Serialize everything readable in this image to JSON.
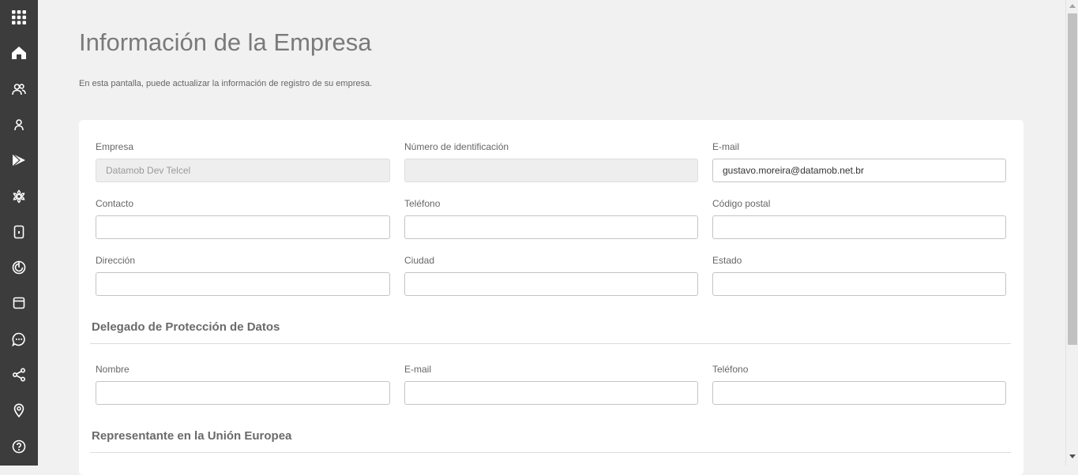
{
  "page": {
    "title": "Información de la Empresa",
    "subtitle": "En esta pantalla, puede actualizar la información de registro de su empresa."
  },
  "sidebar": {
    "items": [
      {
        "icon": "apps-grid-icon"
      },
      {
        "icon": "home-icon"
      },
      {
        "icon": "users-icon"
      },
      {
        "icon": "user-icon"
      },
      {
        "icon": "play-icon"
      },
      {
        "icon": "settings-flower-icon"
      },
      {
        "icon": "device-icon"
      },
      {
        "icon": "target-icon"
      },
      {
        "icon": "browser-window-icon"
      },
      {
        "icon": "chat-icon"
      },
      {
        "icon": "share-icon"
      },
      {
        "icon": "location-pin-icon"
      },
      {
        "icon": "help-icon"
      }
    ]
  },
  "company": {
    "empresa": {
      "label": "Empresa",
      "value": "Datamob Dev Telcel"
    },
    "numero": {
      "label": "Número de identificación",
      "value": ""
    },
    "email": {
      "label": "E-mail",
      "value": "gustavo.moreira@datamob.net.br"
    },
    "contacto": {
      "label": "Contacto",
      "value": ""
    },
    "telefono": {
      "label": "Teléfono",
      "value": ""
    },
    "codigo_postal": {
      "label": "Código postal",
      "value": ""
    },
    "direccion": {
      "label": "Dirección",
      "value": ""
    },
    "ciudad": {
      "label": "Ciudad",
      "value": ""
    },
    "estado": {
      "label": "Estado",
      "value": ""
    }
  },
  "dpo": {
    "title": "Delegado de Protección de Datos",
    "nombre": {
      "label": "Nombre",
      "value": ""
    },
    "email": {
      "label": "E-mail",
      "value": ""
    },
    "telefono": {
      "label": "Teléfono",
      "value": ""
    }
  },
  "eu_rep": {
    "title": "Representante en la Unión Europea"
  },
  "colors": {
    "sidebar_bg": "#3c3c3c",
    "page_bg": "#f1f1f1",
    "card_bg": "#ffffff",
    "title_text": "#7a7a7a"
  }
}
